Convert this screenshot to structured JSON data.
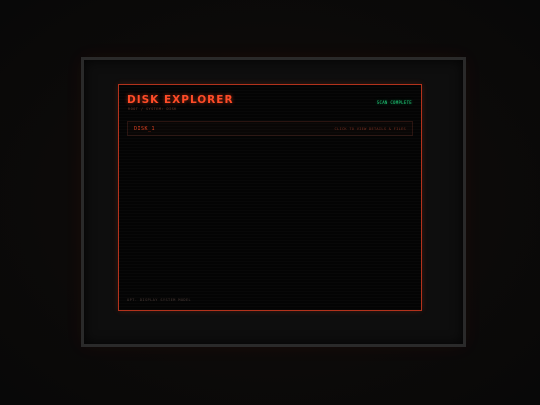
{
  "app": {
    "title": "DISK EXPLORER",
    "root_path": "ROOT / SYSTEM: DISK"
  },
  "status": {
    "label": "SCAN COMPLETE",
    "color": "#1fd07a"
  },
  "disks": [
    {
      "label": "DISK_1",
      "hint": "CLICK TO VIEW DETAILS & FILES"
    }
  ],
  "footer": {
    "text": "OPT. DISPLAY SYSTEM MODEL"
  },
  "colors": {
    "accent": "#ff4a26",
    "border": "#b3321c",
    "background": "#040404"
  }
}
